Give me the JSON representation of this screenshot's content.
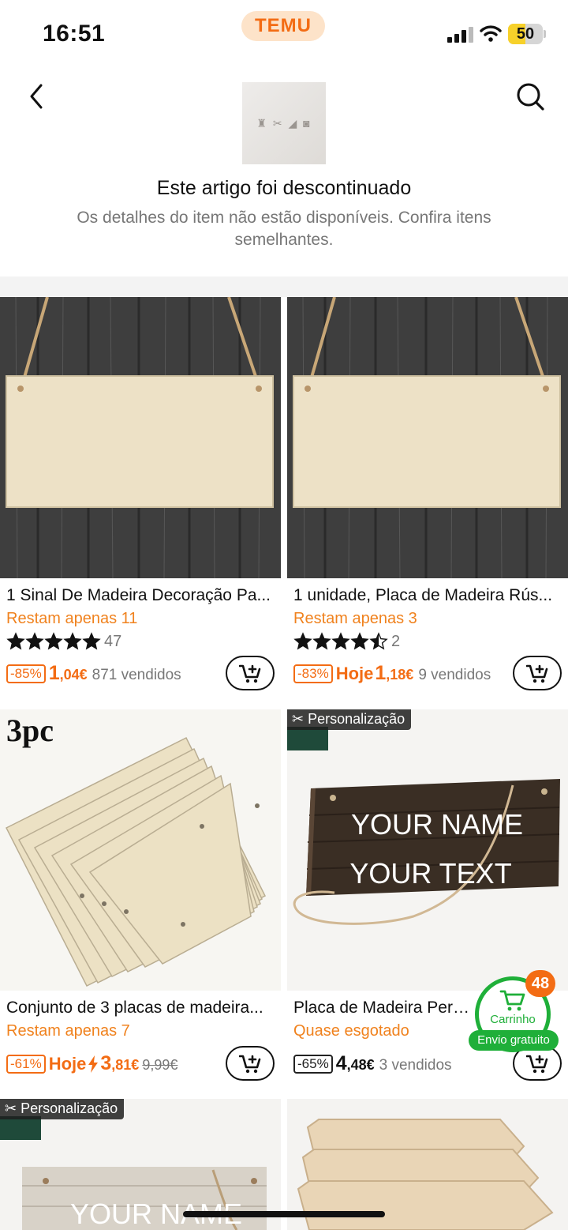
{
  "status": {
    "time": "16:51",
    "brand": "TEMU",
    "battery": "50",
    "battery_level": 0.5
  },
  "header": {
    "thumb_glyphs": "♜ ✂ ◢ ◙"
  },
  "notice": {
    "title": "Este artigo foi descontinuado",
    "subtitle": "Os detalhes do item não estão disponíveis. Confira itens semelhantes."
  },
  "products": [
    {
      "title": "1 Sinal De Madeira Decoração Pa...",
      "stock": "Restam apenas 11",
      "stars": 5,
      "reviews": "47",
      "discount": "-85%",
      "today": "",
      "price_main": "1",
      "price_rest": ",04€",
      "old": "",
      "sold": "871 vendidos"
    },
    {
      "title": "1 unidade, Placa de Madeira Rús...",
      "stock": "Restam apenas 3",
      "stars": 4.5,
      "reviews": "2",
      "discount": "-83%",
      "today": "Hoje",
      "price_main": "1",
      "price_rest": ",18€",
      "old": "",
      "sold": "9 vendidos"
    },
    {
      "title": "Conjunto de 3 placas de madeira...",
      "stock": "Restam apenas 7",
      "badge_text": "3pc",
      "discount": "-61%",
      "today": "Hoje",
      "price_main": "3",
      "price_rest": ",81€",
      "old": "9,99€",
      "sold": ""
    },
    {
      "title": "Placa de Madeira Personalizada...",
      "stock": "Quase esgotado",
      "badge": "Personalização",
      "sign_line1": "YOUR NAME",
      "sign_line2": "YOUR TEXT",
      "discount": "-65%",
      "today": "",
      "price_main": "4",
      "price_rest": ",48€",
      "old": "",
      "sold": "3 vendidos"
    },
    {
      "badge": "Personalização",
      "sign_line1": "YOUR NAME"
    },
    {}
  ],
  "floating_cart": {
    "count": "48",
    "label": "Carrinho",
    "shipping": "Envio gratuito"
  },
  "colors": {
    "accent": "#f36c14",
    "green": "#1faf39",
    "wood_dark": "#3b3b3b",
    "wood_light": "#ede1c6"
  }
}
